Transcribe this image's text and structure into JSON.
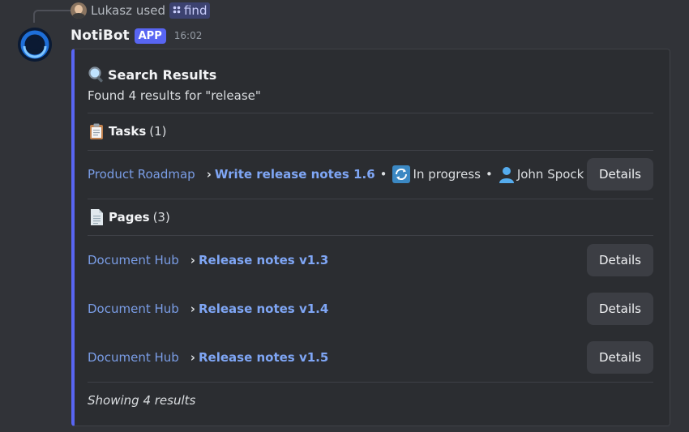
{
  "reply": {
    "user": "Lukasz",
    "verb": "used",
    "command": "find"
  },
  "message": {
    "author": "NotiBot",
    "badge": "APP",
    "time": "16:02"
  },
  "embed": {
    "accent_color": "#5865f2",
    "title": "Search Results",
    "subtitle": "Found 4 results for \"release\"",
    "tasks_section": {
      "label": "Tasks",
      "count": "(1)"
    },
    "tasks": [
      {
        "breadcrumb": "Product Roadmap",
        "separator": "›",
        "title": "Write release notes 1.6",
        "status": "In progress",
        "assignee": "John Spock",
        "button": "Details"
      }
    ],
    "pages_section": {
      "label": "Pages",
      "count": "(3)"
    },
    "pages": [
      {
        "breadcrumb": "Document Hub",
        "separator": "›",
        "title": "Release notes v1.3",
        "button": "Details"
      },
      {
        "breadcrumb": "Document Hub",
        "separator": "›",
        "title": "Release notes v1.4",
        "button": "Details"
      },
      {
        "breadcrumb": "Document Hub",
        "separator": "›",
        "title": "Release notes v1.5",
        "button": "Details"
      }
    ],
    "footer": "Showing 4 results"
  },
  "icons": {
    "title": "magnifying-glass-icon",
    "tasks": "clipboard-icon",
    "pages": "page-icon",
    "status": "repeat-arrows-icon",
    "assignee": "person-silhouette-icon"
  }
}
